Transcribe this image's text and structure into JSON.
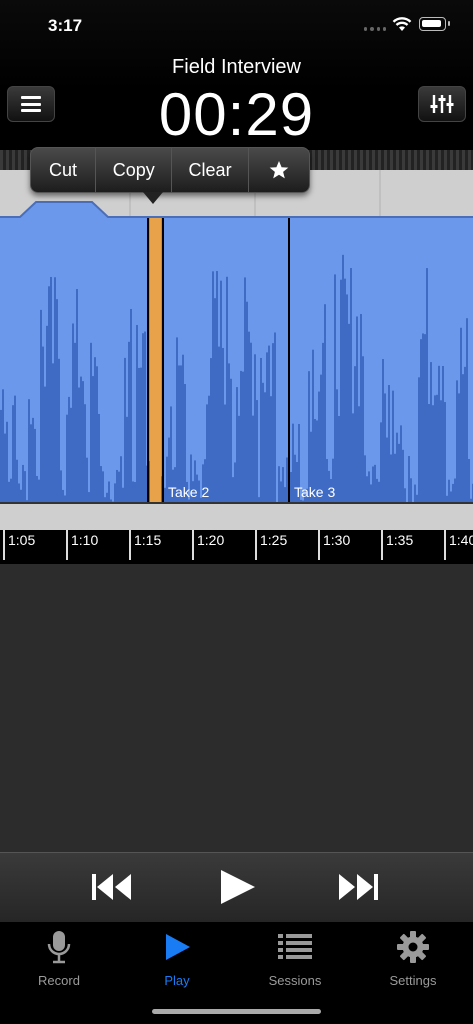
{
  "status_bar": {
    "time": "3:17"
  },
  "header": {
    "title": "Field Interview",
    "timer": "00:29"
  },
  "edit_menu": {
    "cut": "Cut",
    "copy": "Copy",
    "clear": "Clear",
    "favorite_icon": "star-icon"
  },
  "takes": [
    {
      "label": "Take 2"
    },
    {
      "label": "Take 3"
    }
  ],
  "ruler": {
    "ticks": [
      "1:05",
      "1:10",
      "1:15",
      "1:20",
      "1:25",
      "1:30",
      "1:35",
      "1:40"
    ]
  },
  "colors": {
    "waveform_bg": "#6b98ea",
    "waveform_fg": "#3f6bc4",
    "playhead": "#e8a24a",
    "active_tab": "#1a7cf5"
  },
  "tabs": [
    {
      "label": "Record",
      "icon": "microphone-icon",
      "active": false
    },
    {
      "label": "Play",
      "icon": "play-icon",
      "active": true
    },
    {
      "label": "Sessions",
      "icon": "list-icon",
      "active": false
    },
    {
      "label": "Settings",
      "icon": "gear-icon",
      "active": false
    }
  ]
}
